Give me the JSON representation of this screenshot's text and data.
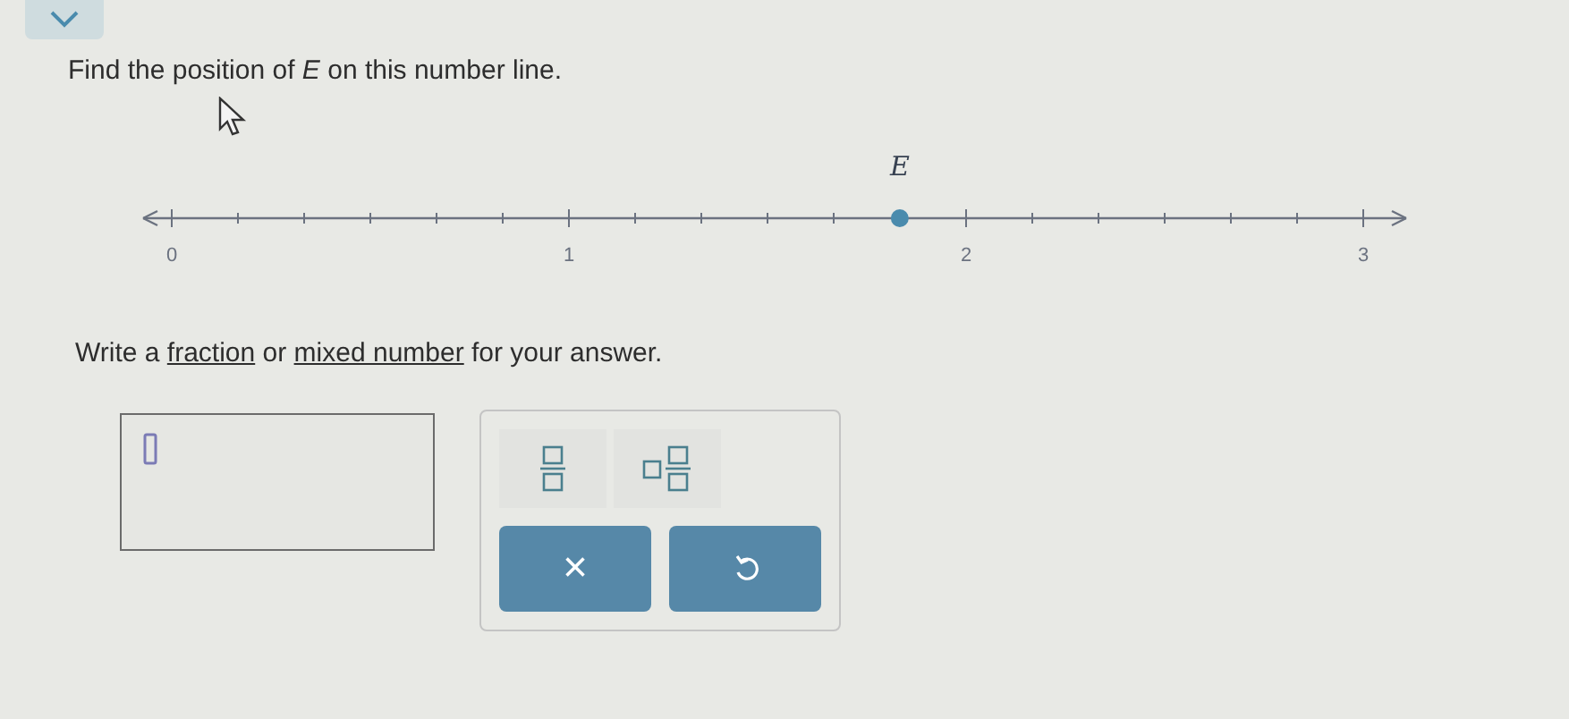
{
  "question": "Find the position of *E* on this number line.",
  "number_line": {
    "point_label": "E",
    "level": 0.611,
    "tick_labels": [
      "0",
      "1",
      "2",
      "3"
    ]
  },
  "instruction": [
    {
      "text": "Write a ",
      "kind": "plain"
    },
    {
      "text": "fraction",
      "kind": "link"
    },
    {
      "text": " or ",
      "kind": "plain"
    },
    {
      "text": "mixed number",
      "kind": "link"
    },
    {
      "text": " for your answer.",
      "kind": "plain"
    }
  ],
  "keypad": {
    "clear_label": "×"
  }
}
